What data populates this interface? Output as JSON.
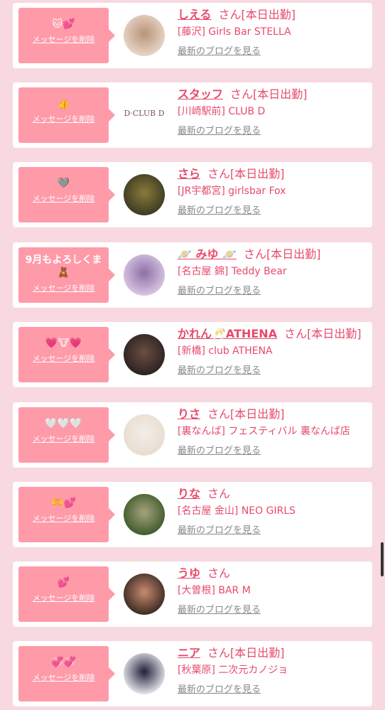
{
  "ui": {
    "delete_label": "メッセージを削除",
    "blog_label": "最新のブログを見る",
    "san_label": "さん",
    "status_label": "[本日出勤]"
  },
  "colors": {
    "background": "#f7d9df",
    "bubble": "#ff9aa9",
    "accent": "#e74a6b",
    "muted": "#888888"
  },
  "messages": [
    {
      "emoji": "🐱💕",
      "name": "しえる",
      "working": true,
      "shop": "[藤沢] Girls Bar STELLA",
      "avatar_colors": [
        "#e8d7c9",
        "#b8947a"
      ]
    },
    {
      "emoji": "👍",
      "name": "スタッフ",
      "working": true,
      "shop": "[川崎駅前] CLUB D",
      "avatar_logo": "D·CLUB D"
    },
    {
      "emoji": "🩶",
      "name": "さら",
      "working": true,
      "shop": "[JR宇都宮] girlsbar Fox",
      "avatar_colors": [
        "#3b3a22",
        "#8a7a3a"
      ]
    },
    {
      "emoji": "9月もよろしくま\n🧸",
      "name": "🪐 みゆ 🪐",
      "working": true,
      "shop": "[名古屋 錦] Teddy Bear",
      "avatar_colors": [
        "#d9c7e3",
        "#8e6fa6"
      ]
    },
    {
      "emoji": "💗🐮💗",
      "name": "かれん🥂ATHENA",
      "working": true,
      "shop": "[新橋] club ATHENA",
      "avatar_colors": [
        "#2b2220",
        "#6b4e42"
      ]
    },
    {
      "emoji": "🤍🤍🤍",
      "name": "りさ",
      "working": true,
      "shop": "[裏なんば] フェスティバル 裏なんば店",
      "avatar_colors": [
        "#e9dcd0",
        "#f2eee8"
      ]
    },
    {
      "emoji": "🫶💕",
      "name": "りな",
      "working": false,
      "shop": "[名古屋 金山] NEO GIRLS",
      "avatar_colors": [
        "#3f5a2a",
        "#a6a37e"
      ]
    },
    {
      "emoji": "💕",
      "name": "うゆ",
      "working": false,
      "shop": "[大曽根] BAR M",
      "avatar_colors": [
        "#3a2a22",
        "#c98a70"
      ]
    },
    {
      "emoji": "💞💞",
      "name": "ニア",
      "working": true,
      "shop": "[秋葉原] 二次元カノジョ",
      "avatar_colors": [
        "#e8e8ef",
        "#1e2238"
      ]
    }
  ]
}
